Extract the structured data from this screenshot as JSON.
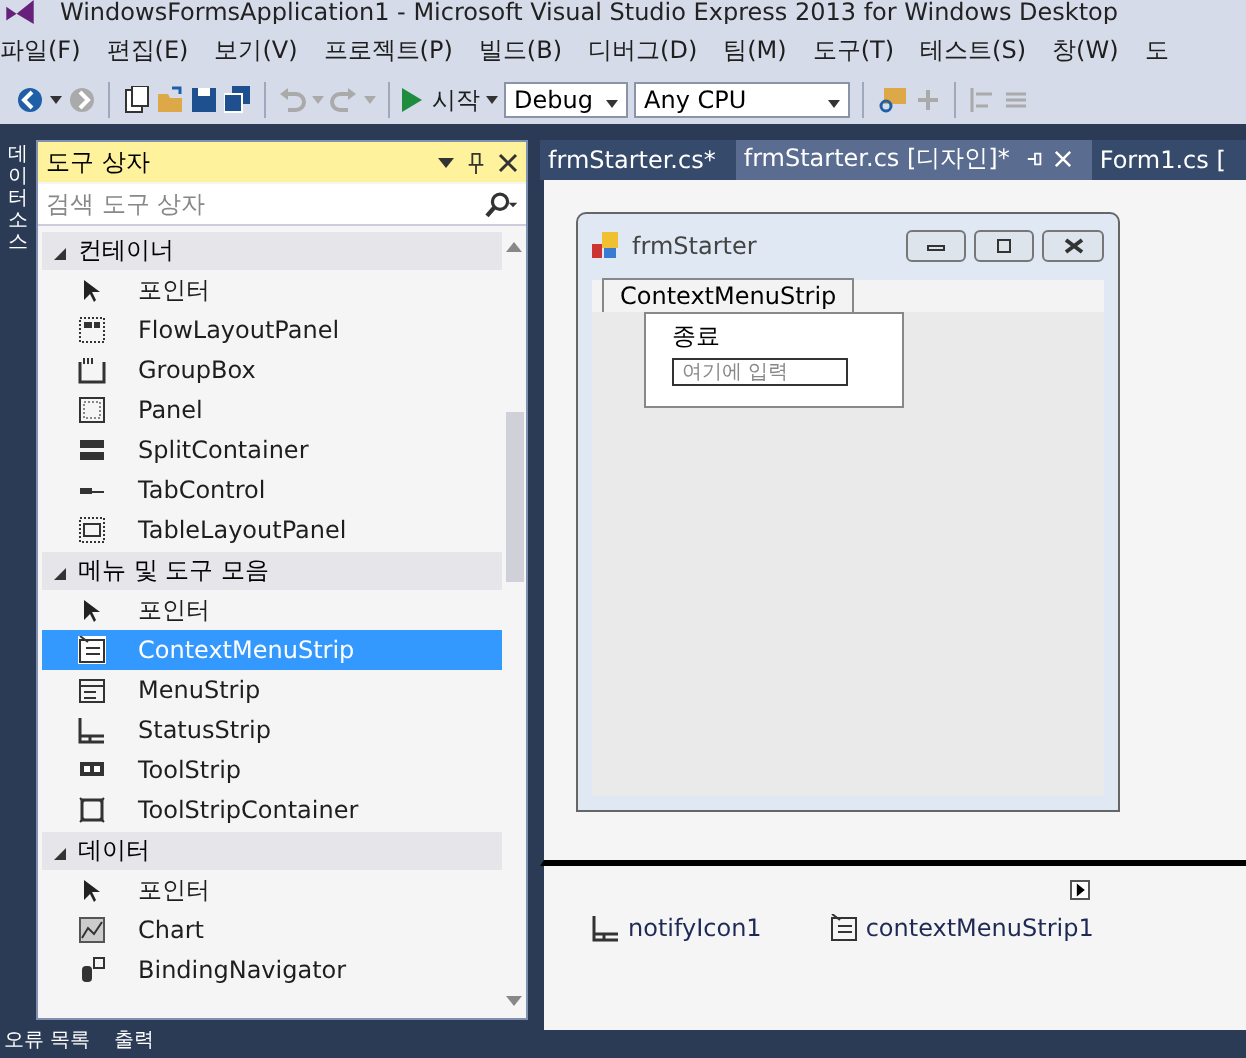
{
  "window": {
    "title": "WindowsFormsApplication1 - Microsoft Visual Studio Express 2013 for Windows Desktop"
  },
  "menu": [
    "파일(F)",
    "편집(E)",
    "보기(V)",
    "프로젝트(P)",
    "빌드(B)",
    "디버그(D)",
    "팀(M)",
    "도구(T)",
    "테스트(S)",
    "창(W)",
    "도"
  ],
  "toolbar": {
    "start": "시작",
    "configuration": "Debug",
    "platform": "Any CPU"
  },
  "side_tab": "데이터 소스",
  "toolbox": {
    "title": "도구 상자",
    "search": {
      "placeholder": "검색 도구 상자"
    },
    "groups": [
      {
        "label": "컨테이너",
        "expanded": true,
        "children": [
          {
            "label": "포인터",
            "selected": false
          },
          {
            "label": "FlowLayoutPanel",
            "selected": false
          },
          {
            "label": "GroupBox",
            "selected": false
          },
          {
            "label": "Panel",
            "selected": false
          },
          {
            "label": "SplitContainer",
            "selected": false
          },
          {
            "label": "TabControl",
            "selected": false
          },
          {
            "label": "TableLayoutPanel",
            "selected": false
          }
        ]
      },
      {
        "label": "메뉴 및 도구 모음",
        "expanded": true,
        "children": [
          {
            "label": "포인터",
            "selected": false
          },
          {
            "label": "ContextMenuStrip",
            "selected": true
          },
          {
            "label": "MenuStrip",
            "selected": false
          },
          {
            "label": "StatusStrip",
            "selected": false
          },
          {
            "label": "ToolStrip",
            "selected": false
          },
          {
            "label": "ToolStripContainer",
            "selected": false
          }
        ]
      },
      {
        "label": "데이터",
        "expanded": true,
        "children": [
          {
            "label": "포인터",
            "selected": false
          },
          {
            "label": "Chart",
            "selected": false
          },
          {
            "label": "BindingNavigator",
            "selected": false
          }
        ]
      }
    ]
  },
  "tabs": [
    {
      "label": "frmStarter.cs*",
      "selected": false
    },
    {
      "label": "frmStarter.cs [디자인]*",
      "selected": true
    },
    {
      "label": "Form1.cs [",
      "selected": false
    }
  ],
  "form": {
    "title": "frmStarter",
    "menu_tab": "ContextMenuStrip",
    "menu_items": [
      "종료"
    ],
    "new_item": {
      "placeholder": "여기에 입력"
    }
  },
  "tray": [
    "notifyIcon1",
    "contextMenuStrip1"
  ],
  "bottom_tabs": [
    "오류 목록",
    "출력"
  ]
}
